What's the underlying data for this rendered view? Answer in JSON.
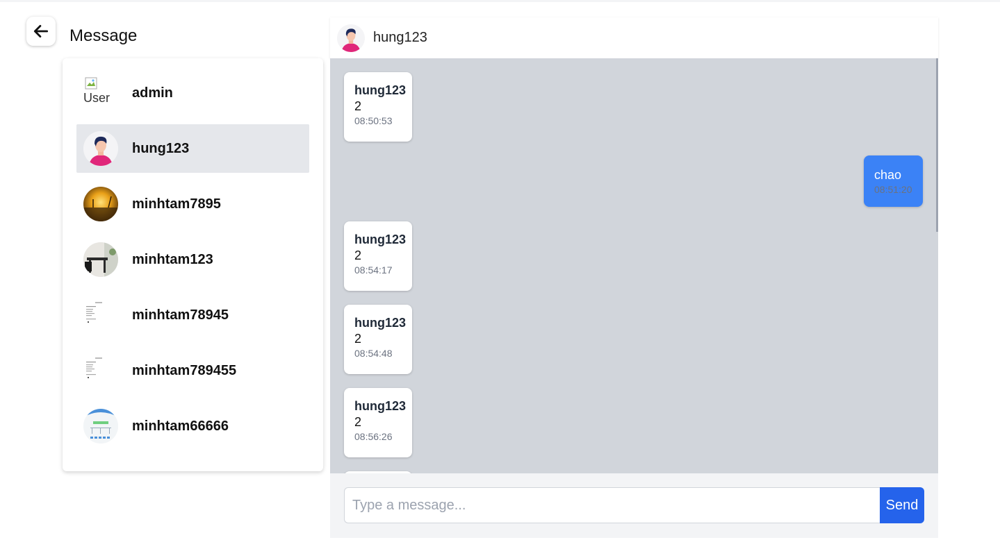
{
  "header": {
    "title": "Message",
    "back_icon": "arrow-left-icon"
  },
  "contacts": [
    {
      "name": "admin",
      "avatar_alt": "User",
      "avatar": "broken-image"
    },
    {
      "name": "hung123",
      "avatar": "boy-avatar",
      "active": true
    },
    {
      "name": "minhtam7895",
      "avatar": "sunset-photo"
    },
    {
      "name": "minhtam123",
      "avatar": "room-photo"
    },
    {
      "name": "minhtam78945",
      "avatar": "document-thumbnail"
    },
    {
      "name": "minhtam789455",
      "avatar": "document-thumbnail"
    },
    {
      "name": "minhtam66666",
      "avatar": "diagram-thumbnail"
    }
  ],
  "chat": {
    "title": "hung123",
    "messages": [
      {
        "sender": "hung123",
        "text": "2",
        "time": "08:50:53",
        "mine": false
      },
      {
        "sender": "",
        "text": "chao",
        "time": "08:51:20",
        "mine": true
      },
      {
        "sender": "hung123",
        "text": "2",
        "time": "08:54:17",
        "mine": false
      },
      {
        "sender": "hung123",
        "text": "2",
        "time": "08:54:48",
        "mine": false
      },
      {
        "sender": "hung123",
        "text": "2",
        "time": "08:56:26",
        "mine": false
      }
    ],
    "input_placeholder": "Type a message...",
    "input_value": "",
    "send_label": "Send"
  },
  "colors": {
    "accent": "#2563eb",
    "my_bubble": "#3b82f6",
    "chat_bg": "#d1d5db",
    "active_contact": "#e5e7eb"
  }
}
